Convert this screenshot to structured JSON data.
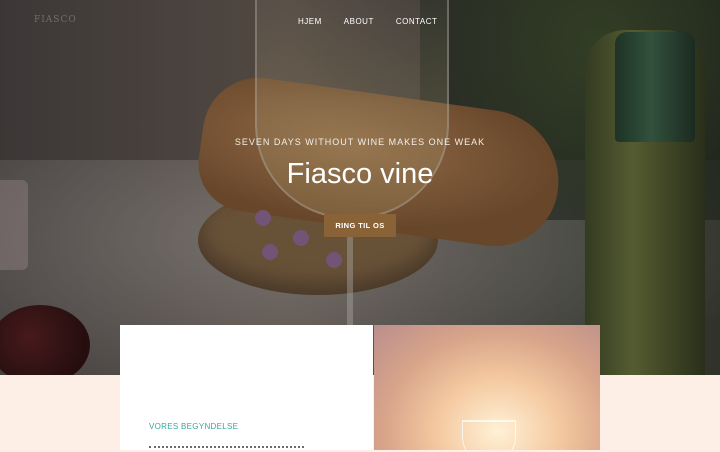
{
  "brand": {
    "logo_text": "FIASCO"
  },
  "nav": {
    "items": [
      "HJEM",
      "ABOUT",
      "CONTACT"
    ]
  },
  "hero": {
    "tagline": "SEVEN DAYS WITHOUT WINE MAKES ONE WEAK",
    "title": "Fiasco vine",
    "cta_label": "RING TIL OS"
  },
  "about": {
    "eyebrow": "VORES BEGYNDELSE"
  },
  "colors": {
    "accent": "#8a6238",
    "teal": "#3aa79a",
    "section_bg": "#fdeee6"
  }
}
